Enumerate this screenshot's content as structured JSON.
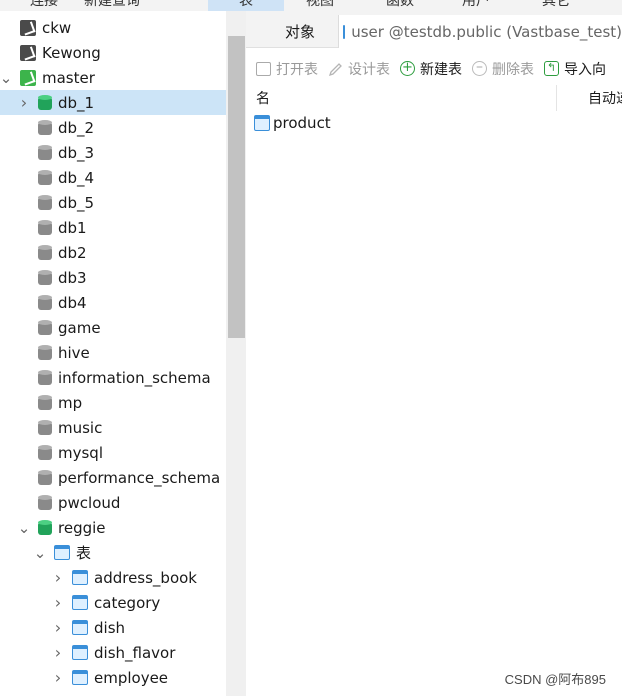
{
  "menu": {
    "items": [
      "连接",
      "新建查询",
      "表",
      "视图",
      "函数",
      "用户",
      "其它"
    ]
  },
  "tree": {
    "rows": [
      {
        "label": "ckw",
        "icon": "connection-icon",
        "level": 0
      },
      {
        "label": "Kewong",
        "icon": "connection-icon",
        "level": 0
      },
      {
        "label": "master",
        "icon": "connection-icon",
        "level": 0,
        "expanded": true
      },
      {
        "label": "db_1",
        "icon": "database-icon",
        "level": 1,
        "selected": true
      },
      {
        "label": "db_2",
        "icon": "database-icon",
        "level": 1
      },
      {
        "label": "db_3",
        "icon": "database-icon",
        "level": 1
      },
      {
        "label": "db_4",
        "icon": "database-icon",
        "level": 1
      },
      {
        "label": "db_5",
        "icon": "database-icon",
        "level": 1
      },
      {
        "label": "db1",
        "icon": "database-icon",
        "level": 1
      },
      {
        "label": "db2",
        "icon": "database-icon",
        "level": 1
      },
      {
        "label": "db3",
        "icon": "database-icon",
        "level": 1
      },
      {
        "label": "db4",
        "icon": "database-icon",
        "level": 1
      },
      {
        "label": "game",
        "icon": "database-icon",
        "level": 1
      },
      {
        "label": "hive",
        "icon": "database-icon",
        "level": 1
      },
      {
        "label": "information_schema",
        "icon": "database-icon",
        "level": 1
      },
      {
        "label": "mp",
        "icon": "database-icon",
        "level": 1
      },
      {
        "label": "music",
        "icon": "database-icon",
        "level": 1
      },
      {
        "label": "mysql",
        "icon": "database-icon",
        "level": 1
      },
      {
        "label": "performance_schema",
        "icon": "database-icon",
        "level": 1
      },
      {
        "label": "pwcloud",
        "icon": "database-icon",
        "level": 1
      },
      {
        "label": "reggie",
        "icon": "database-icon",
        "level": 1,
        "expanded": true
      },
      {
        "label": "表",
        "icon": "table-group-icon",
        "level": 2,
        "expanded": true
      },
      {
        "label": "address_book",
        "icon": "table-icon",
        "level": 3
      },
      {
        "label": "category",
        "icon": "table-icon",
        "level": 3
      },
      {
        "label": "dish",
        "icon": "table-icon",
        "level": 3
      },
      {
        "label": "dish_flavor",
        "icon": "table-icon",
        "level": 3
      },
      {
        "label": "employee",
        "icon": "table-icon",
        "level": 3
      }
    ]
  },
  "tabs": {
    "objects": "对象",
    "user_tab": "user @testdb.public (Vastbase_test)"
  },
  "toolbar": {
    "open_table": "打开表",
    "design_table": "设计表",
    "new_table": "新建表",
    "delete_table": "删除表",
    "import_wizard": "导入向"
  },
  "list": {
    "col_name": "名",
    "col_auto": "自动递",
    "rows": [
      {
        "name": "product"
      }
    ]
  },
  "watermark": "CSDN @阿布895",
  "colors": {
    "selection": "#cce4f7",
    "accent_green": "#2e9d3f",
    "table_blue": "#3a8fd9"
  }
}
